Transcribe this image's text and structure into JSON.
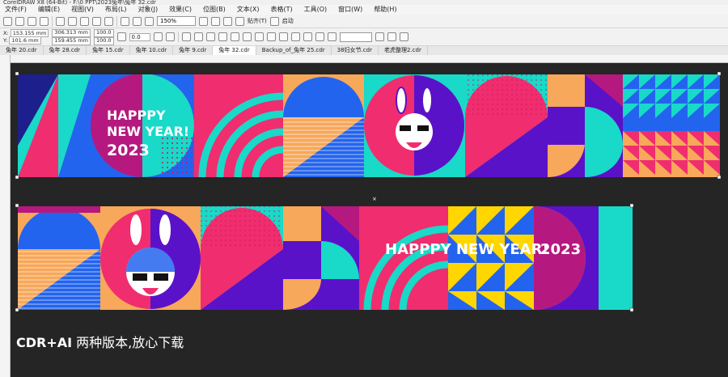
{
  "window": {
    "title": "CorelDRAW X8 (64-Bit) - F:\\0 PPT\\2023兔年\\兔年 32.cdr"
  },
  "menu": [
    "文件(F)",
    "编辑(E)",
    "视图(V)",
    "布局(L)",
    "对象(J)",
    "效果(C)",
    "位图(B)",
    "文本(X)",
    "表格(T)",
    "工具(O)",
    "窗口(W)",
    "帮助(H)"
  ],
  "toolbar": {
    "zoom": "150%",
    "snap_label": "贴齐(T)",
    "launch_label": "启动"
  },
  "properties": {
    "x": "153.155 mm",
    "y": "101.6 mm",
    "width": "306.313 mm",
    "height": "159.455 mm",
    "scale_x": "100.0",
    "scale_y": "100.0",
    "angle": "0.0"
  },
  "tabs": [
    "兔年 20.cdr",
    "兔年 28.cdr",
    "兔年 15.cdr",
    "兔年 10.cdr",
    "兔年 9.cdr",
    "兔年 32.cdr",
    "Backup_of_兔年 25.cdr",
    "38妇女节.cdr",
    "老虎整理2.cdr"
  ],
  "active_tab": "兔年 32.cdr",
  "banner1": {
    "line1": "HAPPPY",
    "line2": "NEW YEAR!",
    "year": "2023"
  },
  "banner2": {
    "line1": "HAPPPY  NEW YEAR!",
    "year": "2023"
  },
  "bottom_caption": {
    "bold": "CDR+AI",
    "rest": " 两种版本,放心下载"
  },
  "colors": {
    "pink": "#f02d6e",
    "cyan": "#19d9c8",
    "purple": "#5a12c9",
    "blue": "#2364ee",
    "orange": "#f7a85a",
    "magenta": "#b5197f",
    "yellow": "#ffd600",
    "navy": "#1d1f8c"
  }
}
